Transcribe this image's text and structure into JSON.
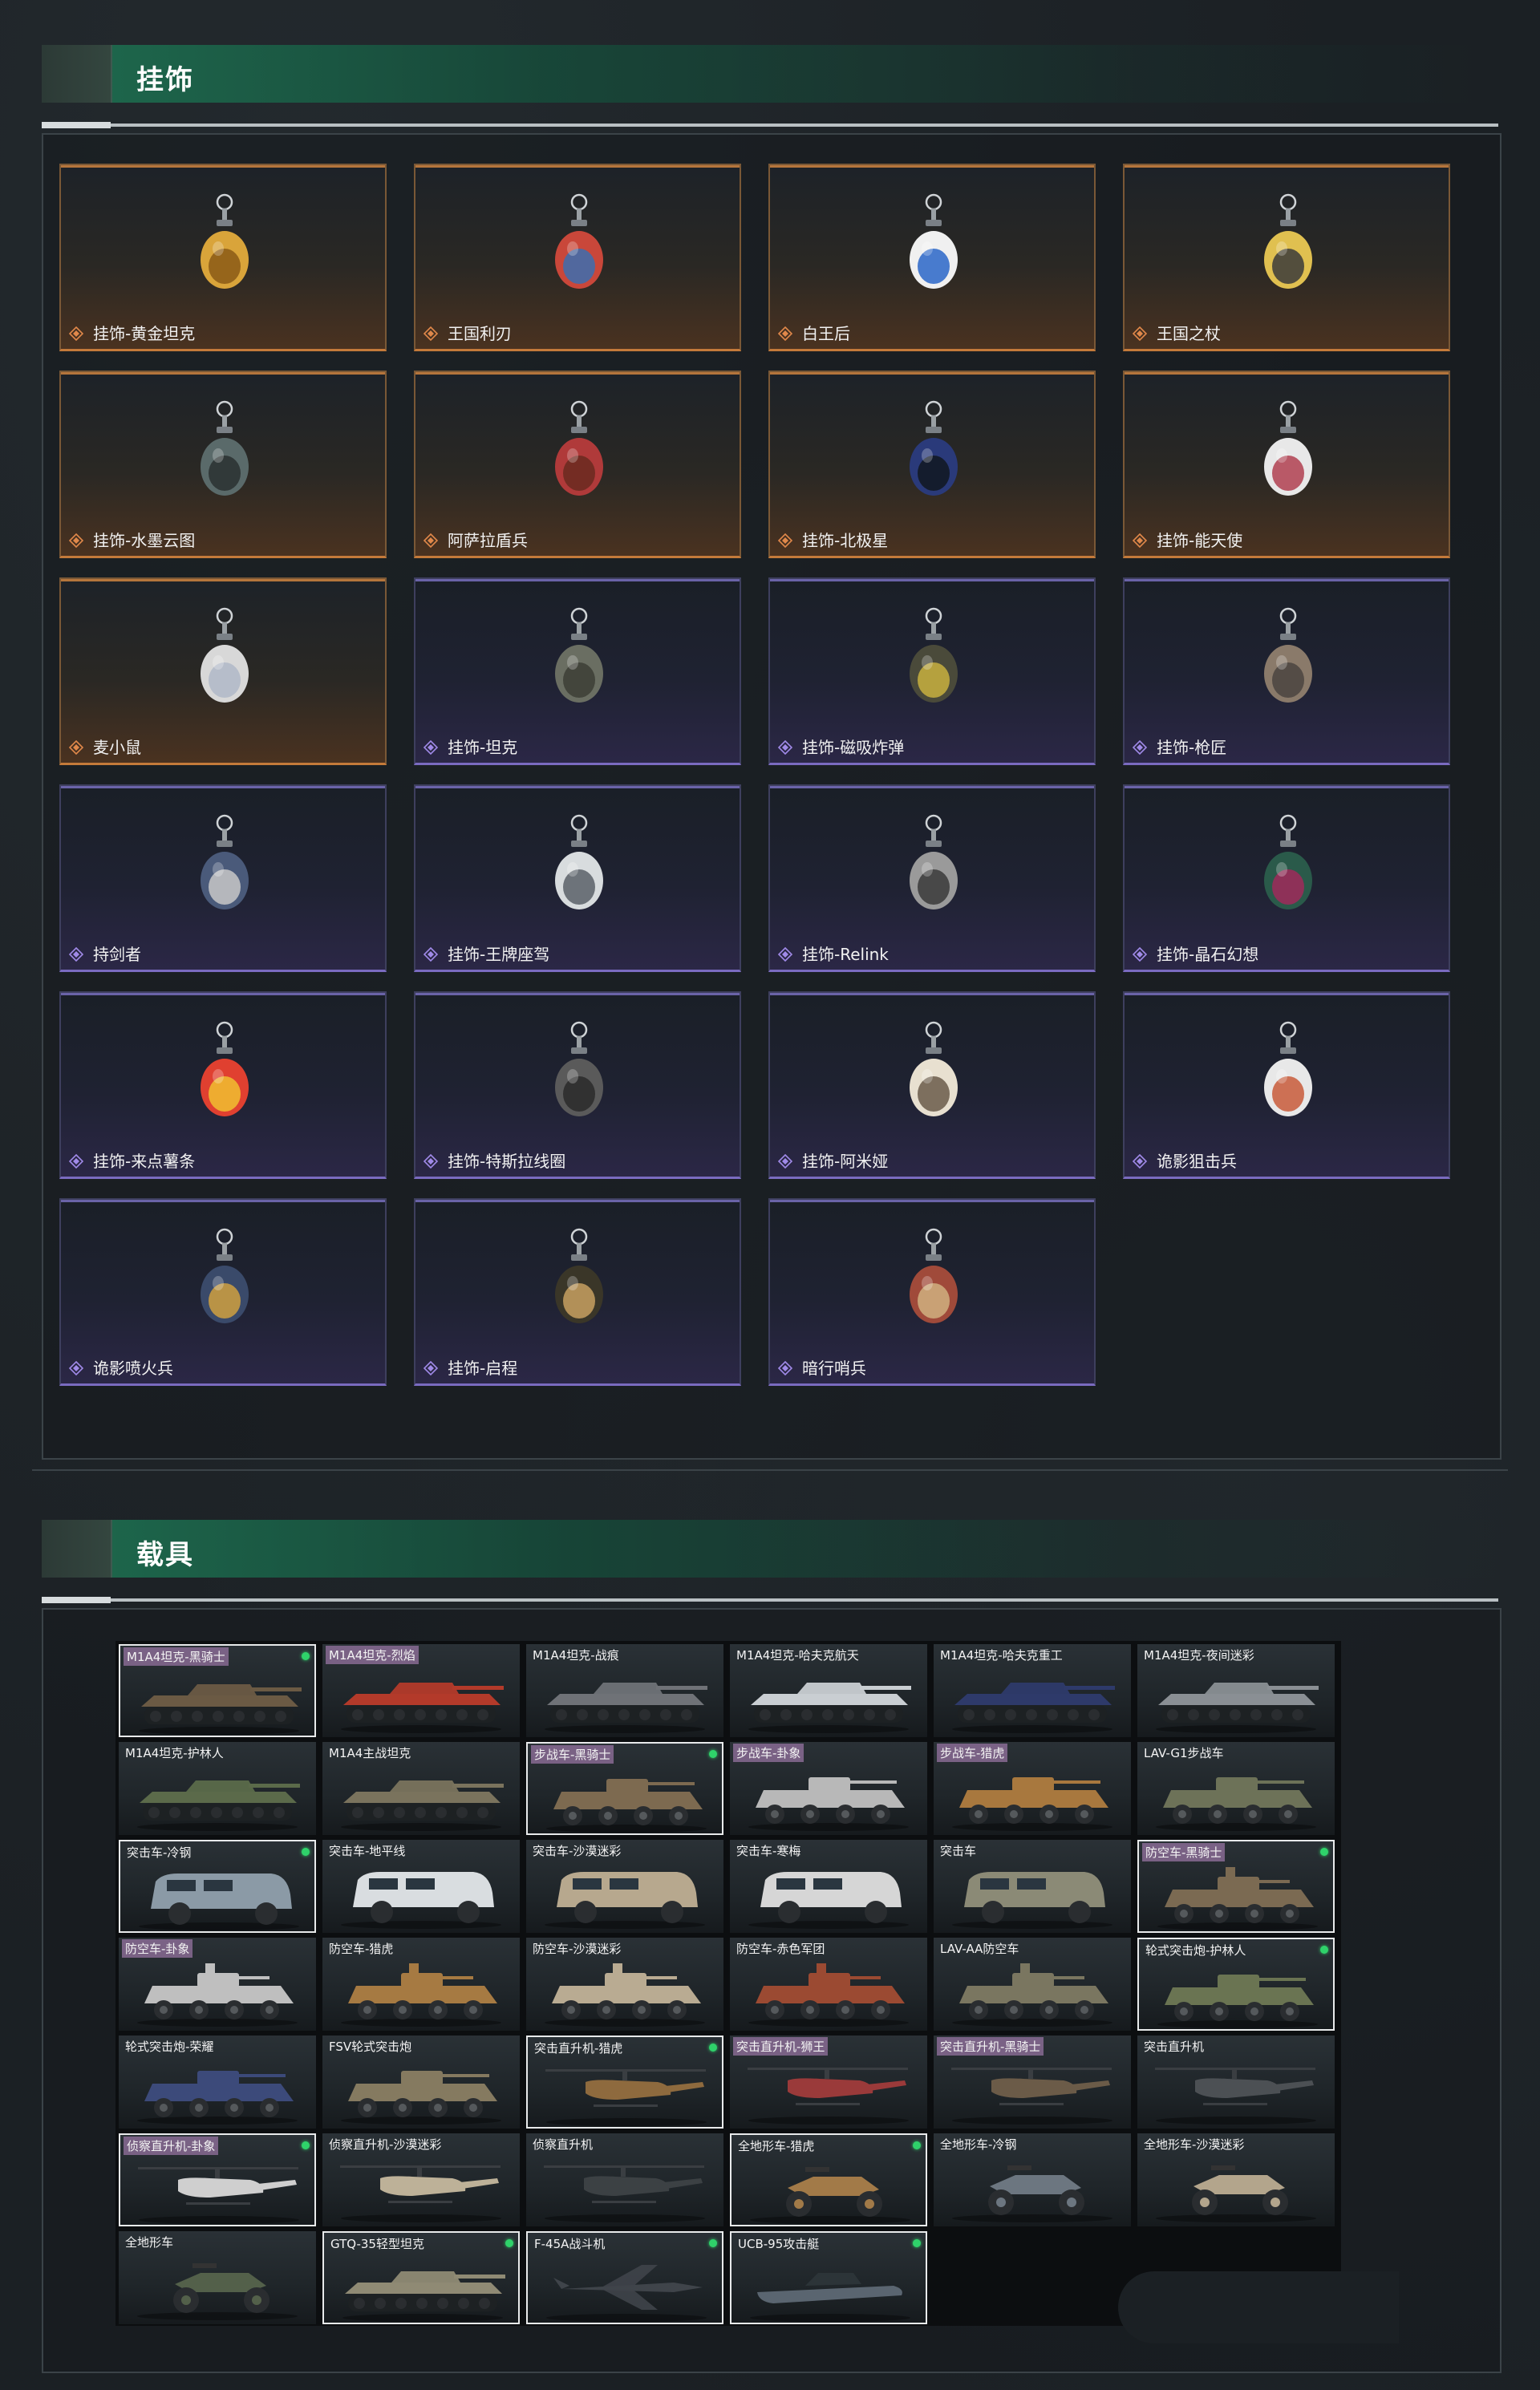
{
  "sections": {
    "pendants": {
      "title": "挂饰"
    },
    "vehicles": {
      "title": "载具"
    }
  },
  "pendants": [
    {
      "name": "挂饰-黄金坦克",
      "rarity": "gold",
      "icon": "gold-tank-pendant"
    },
    {
      "name": "王国利刃",
      "rarity": "gold",
      "icon": "knight-pendant"
    },
    {
      "name": "白王后",
      "rarity": "gold",
      "icon": "white-queen-pendant"
    },
    {
      "name": "王国之杖",
      "rarity": "gold",
      "icon": "king-scepter-pendant"
    },
    {
      "name": "挂饰-水墨云图",
      "rarity": "gold",
      "icon": "ink-ball-pendant"
    },
    {
      "name": "阿萨拉盾兵",
      "rarity": "gold",
      "icon": "shield-soldier-pendant"
    },
    {
      "name": "挂饰-北极星",
      "rarity": "gold",
      "icon": "polaris-pendant"
    },
    {
      "name": "挂饰-能天使",
      "rarity": "gold",
      "icon": "exusiai-pendant"
    },
    {
      "name": "麦小鼠",
      "rarity": "gold",
      "icon": "mouse-pendant"
    },
    {
      "name": "挂饰-坦克",
      "rarity": "purple",
      "icon": "tank-pendant"
    },
    {
      "name": "挂饰-磁吸炸弹",
      "rarity": "purple",
      "icon": "magnet-bomb-pendant"
    },
    {
      "name": "挂饰-枪匠",
      "rarity": "purple",
      "icon": "gunsmith-pendant"
    },
    {
      "name": "持剑者",
      "rarity": "purple",
      "icon": "swordsman-pendant"
    },
    {
      "name": "挂饰-王牌座驾",
      "rarity": "purple",
      "icon": "jet-pendant"
    },
    {
      "name": "挂饰-Relink",
      "rarity": "purple",
      "icon": "relink-pendant"
    },
    {
      "name": "挂饰-晶石幻想",
      "rarity": "purple",
      "icon": "crystal-pendant"
    },
    {
      "name": "挂饰-来点薯条",
      "rarity": "purple",
      "icon": "fries-pendant"
    },
    {
      "name": "挂饰-特斯拉线圈",
      "rarity": "purple",
      "icon": "tesla-coil-pendant"
    },
    {
      "name": "挂饰-阿米娅",
      "rarity": "purple",
      "icon": "amiya-pendant"
    },
    {
      "name": "诡影狙击兵",
      "rarity": "purple",
      "icon": "sniper-pendant"
    },
    {
      "name": "诡影喷火兵",
      "rarity": "purple",
      "icon": "flamer-pendant"
    },
    {
      "name": "挂饰-启程",
      "rarity": "purple",
      "icon": "departure-pendant"
    },
    {
      "name": "暗行哨兵",
      "rarity": "purple",
      "icon": "sentinel-pendant"
    }
  ],
  "vehicles": [
    {
      "name": "M1A4坦克-黑骑士",
      "owned": true,
      "pink": true,
      "kind": "tank",
      "color": "#6b5a44"
    },
    {
      "name": "M1A4坦克-烈焰",
      "owned": false,
      "pink": true,
      "kind": "tank",
      "color": "#b33a2a"
    },
    {
      "name": "M1A4坦克-战痕",
      "owned": false,
      "pink": false,
      "kind": "tank",
      "color": "#6f7277"
    },
    {
      "name": "M1A4坦克-哈夫克航天",
      "owned": false,
      "pink": false,
      "kind": "tank",
      "color": "#c9ced2"
    },
    {
      "name": "M1A4坦克-哈夫克重工",
      "owned": false,
      "pink": false,
      "kind": "tank",
      "color": "#2e3a6a"
    },
    {
      "name": "M1A4坦克-夜间迷彩",
      "owned": false,
      "pink": false,
      "kind": "tank",
      "color": "#8a8f94"
    },
    {
      "name": "M1A4坦克-护林人",
      "owned": false,
      "pink": false,
      "kind": "tank",
      "color": "#5b6a4a"
    },
    {
      "name": "M1A4主战坦克",
      "owned": false,
      "pink": false,
      "kind": "tank",
      "color": "#7a735d"
    },
    {
      "name": "步战车-黑骑士",
      "owned": true,
      "pink": true,
      "kind": "ifv",
      "color": "#7d6a50"
    },
    {
      "name": "步战车-卦象",
      "owned": false,
      "pink": true,
      "kind": "ifv",
      "color": "#b8b8b8"
    },
    {
      "name": "步战车-猎虎",
      "owned": false,
      "pink": true,
      "kind": "ifv",
      "color": "#a8783e"
    },
    {
      "name": "LAV-G1步战车",
      "owned": false,
      "pink": false,
      "kind": "ifv",
      "color": "#6d7258"
    },
    {
      "name": "突击车-冷钢",
      "owned": true,
      "pink": false,
      "kind": "assault",
      "color": "#8b9aa6"
    },
    {
      "name": "突击车-地平线",
      "owned": false,
      "pink": false,
      "kind": "assault",
      "color": "#d9dde0"
    },
    {
      "name": "突击车-沙漠迷彩",
      "owned": false,
      "pink": false,
      "kind": "assault",
      "color": "#b7a88e"
    },
    {
      "name": "突击车-寒梅",
      "owned": false,
      "pink": false,
      "kind": "assault",
      "color": "#d6d6d6"
    },
    {
      "name": "突击车",
      "owned": false,
      "pink": false,
      "kind": "assault",
      "color": "#8b8a76"
    },
    {
      "name": "防空车-黑骑士",
      "owned": true,
      "pink": true,
      "kind": "aa",
      "color": "#7b6a52"
    },
    {
      "name": "防空车-卦象",
      "owned": false,
      "pink": true,
      "kind": "aa",
      "color": "#bfbfbf"
    },
    {
      "name": "防空车-猎虎",
      "owned": false,
      "pink": false,
      "kind": "aa",
      "color": "#a67a42"
    },
    {
      "name": "防空车-沙漠迷彩",
      "owned": false,
      "pink": false,
      "kind": "aa",
      "color": "#b9ab92"
    },
    {
      "name": "防空车-赤色军团",
      "owned": false,
      "pink": false,
      "kind": "aa",
      "color": "#9b4a32"
    },
    {
      "name": "LAV-AA防空车",
      "owned": false,
      "pink": false,
      "kind": "aa",
      "color": "#7a7660"
    },
    {
      "name": "轮式突击炮-护林人",
      "owned": true,
      "pink": false,
      "kind": "wheeled",
      "color": "#6a7452"
    },
    {
      "name": "轮式突击炮-荣耀",
      "owned": false,
      "pink": false,
      "kind": "wheeled",
      "color": "#3c4a7a"
    },
    {
      "name": "FSV轮式突击炮",
      "owned": false,
      "pink": false,
      "kind": "wheeled",
      "color": "#857a60"
    },
    {
      "name": "突击直升机-猎虎",
      "owned": true,
      "pink": false,
      "kind": "heli",
      "color": "#8e6a3e"
    },
    {
      "name": "突击直升机-狮王",
      "owned": false,
      "pink": true,
      "kind": "heli",
      "color": "#9a3a3a"
    },
    {
      "name": "突击直升机-黑骑士",
      "owned": false,
      "pink": true,
      "kind": "heli",
      "color": "#6b5b48"
    },
    {
      "name": "突击直升机",
      "owned": false,
      "pink": false,
      "kind": "heli",
      "color": "#4c5054"
    },
    {
      "name": "侦察直升机-卦象",
      "owned": true,
      "pink": true,
      "kind": "scout",
      "color": "#cfcfcf"
    },
    {
      "name": "侦察直升机-沙漠迷彩",
      "owned": false,
      "pink": false,
      "kind": "scout",
      "color": "#bdb198"
    },
    {
      "name": "侦察直升机",
      "owned": false,
      "pink": false,
      "kind": "scout",
      "color": "#3c4144"
    },
    {
      "name": "全地形车-猎虎",
      "owned": true,
      "pink": false,
      "kind": "atv",
      "color": "#a27a48"
    },
    {
      "name": "全地形车-冷钢",
      "owned": false,
      "pink": false,
      "kind": "atv",
      "color": "#6c7680"
    },
    {
      "name": "全地形车-沙漠迷彩",
      "owned": false,
      "pink": false,
      "kind": "atv",
      "color": "#b3a58c"
    },
    {
      "name": "全地形车",
      "owned": false,
      "pink": false,
      "kind": "atv",
      "color": "#53604a"
    },
    {
      "name": "GTQ-35轻型坦克",
      "owned": true,
      "pink": false,
      "kind": "lighttank",
      "color": "#8f8a74"
    },
    {
      "name": "F-45A战斗机",
      "owned": true,
      "pink": false,
      "kind": "jet",
      "color": "#3f444a"
    },
    {
      "name": "UCB-95攻击艇",
      "owned": true,
      "pink": false,
      "kind": "boat",
      "color": "#5a6570"
    }
  ],
  "colors": {
    "gold_border": "#c47a3a",
    "purple_border": "#7a6bc0",
    "owned_dot": "#2fd26a",
    "header_green": "#1e6e50"
  }
}
